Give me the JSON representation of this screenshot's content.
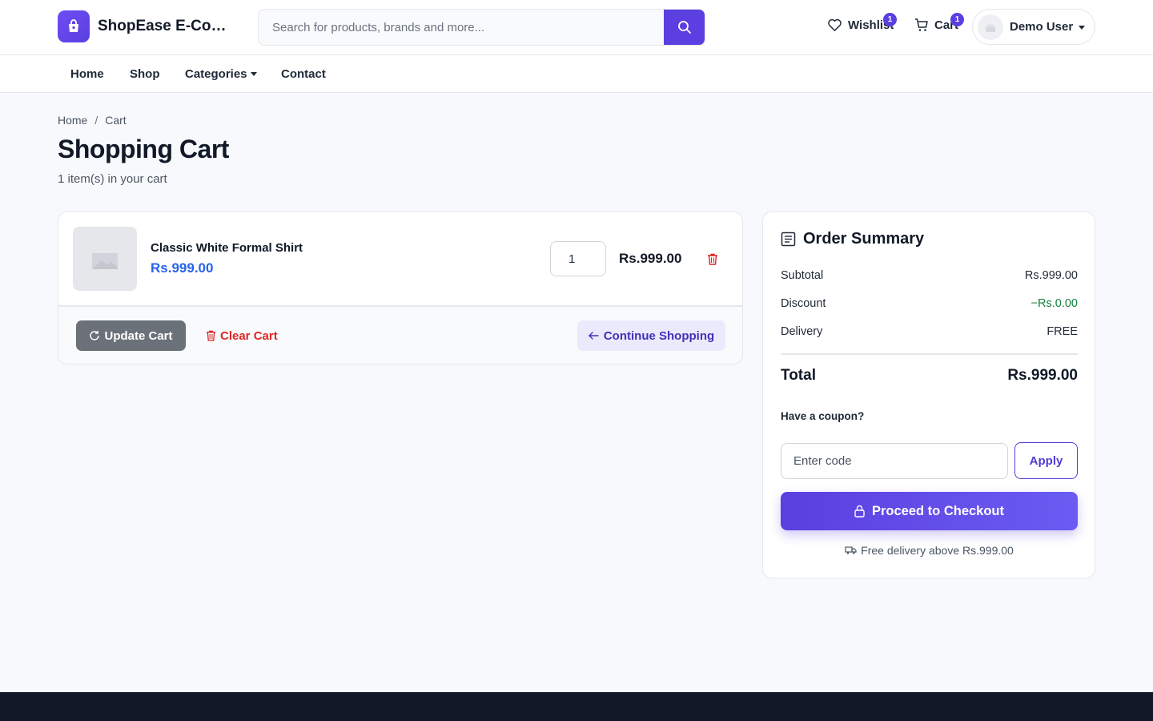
{
  "header": {
    "brand": "ShopEase E-Commerce",
    "search_placeholder": "Search for products, brands and more...",
    "wishlist_label": "Wishlist",
    "wishlist_count": "1",
    "cart_label": "Cart",
    "cart_count": "1",
    "user_name": "Demo User"
  },
  "nav": {
    "items": [
      "Home",
      "Shop",
      "Categories",
      "Contact"
    ]
  },
  "breadcrumb": [
    "Home",
    "Cart"
  ],
  "page": {
    "title": "Shopping Cart",
    "item_count": "1 item(s) in your cart"
  },
  "cart": {
    "items": [
      {
        "name": "Classic White Formal Shirt",
        "price": "Rs.999.00",
        "quantity": "1",
        "line_total": "Rs.999.00"
      }
    ],
    "update_label": "Update Cart",
    "clear_label": "Clear Cart",
    "continue_label": "Continue Shopping"
  },
  "summary": {
    "title": "Order Summary",
    "rows": [
      {
        "label": "Subtotal",
        "value": "Rs.999.00"
      },
      {
        "label": "Discount",
        "value": "−Rs.0.00"
      },
      {
        "label": "Delivery",
        "value": "FREE"
      }
    ],
    "total_label": "Total",
    "total_value": "Rs.999.00",
    "coupon_label": "Have a coupon?",
    "coupon_placeholder": "Enter code",
    "apply_label": "Apply",
    "checkout_label": "Proceed to Checkout",
    "delivery_note": "Free delivery above Rs.999.00"
  },
  "colors": {
    "accent": "#5b3fe0",
    "price_blue": "#2563eb",
    "discount_green": "#15803d",
    "danger": "#dc2626"
  }
}
